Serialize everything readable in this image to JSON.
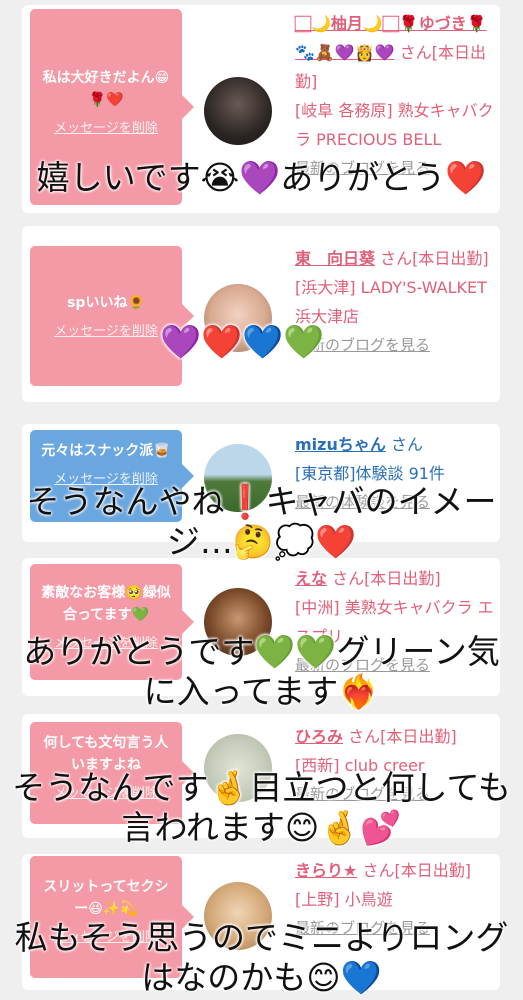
{
  "cards": [
    {
      "bubble_text": "私は大好きだよん😁🌹❤️",
      "delete_label": "メッセージを削除",
      "name": "🏻🌙柚月🌙🏻🌹ゆづき🌹🐾🧸💜👸💜",
      "san": "さん[本日出勤]",
      "location": "[岐阜 各務原] 熟女キャバクラ PRECIOUS BELL",
      "blog": "最新のブログを見る"
    },
    {
      "bubble_text": "spいいね🌻",
      "delete_label": "メッセージを削除",
      "name": "東　向日葵",
      "san": "さん[本日出勤]",
      "location": "[浜大津] LADY'S-WALKET 浜大津店",
      "blog": "最新のブログを見る"
    },
    {
      "bubble_text": "元々はスナック派🥃",
      "delete_label": "メッセージを削除",
      "name": "mizuちゃん",
      "san": "さん",
      "location": "[東京都]体験談 91件",
      "blog": "最新の体験談を見る"
    },
    {
      "bubble_text": "素敵なお客様🥺緑似合ってます💚",
      "delete_label": "メッセージを削除",
      "name": "えな",
      "san": "さん[本日出勤]",
      "location": "[中洲] 美熟女キャバクラ エスプリ",
      "blog": "最新のブログを見る"
    },
    {
      "bubble_text": "何しても文句言う人いますよね",
      "delete_label": "メッセージを削除",
      "name": "ひろみ",
      "san": "さん[本日出勤]",
      "location": "[西新] club creer",
      "blog": "最新のブログを見る"
    },
    {
      "bubble_text": "スリットってセクシー😆✨💫",
      "delete_label": "メッセージを削除",
      "name": "きらり★",
      "san": "さん[本日出勤]",
      "location": "[上野] 小鳥遊",
      "blog": "最新のブログを見る"
    }
  ],
  "captions": [
    "嬉しいです😭💜ありがとう❤️",
    "💜❤️💙💚",
    "そうなんやね❗️キャバのイメージ…🤔💭❤️",
    "ありがとうです💚💚グリーン気に入ってます❤️‍🔥",
    "そうなんです🤞目立つと何しても言われます😊🤞💕",
    "私もそう思うのでミニよりロングはなのかも😊💙"
  ],
  "colors": {
    "pink_bubble": "#f49aa6",
    "blue_bubble": "#6aa6e0",
    "name_pink": "#e0607a",
    "name_blue": "#2a6fb8"
  }
}
